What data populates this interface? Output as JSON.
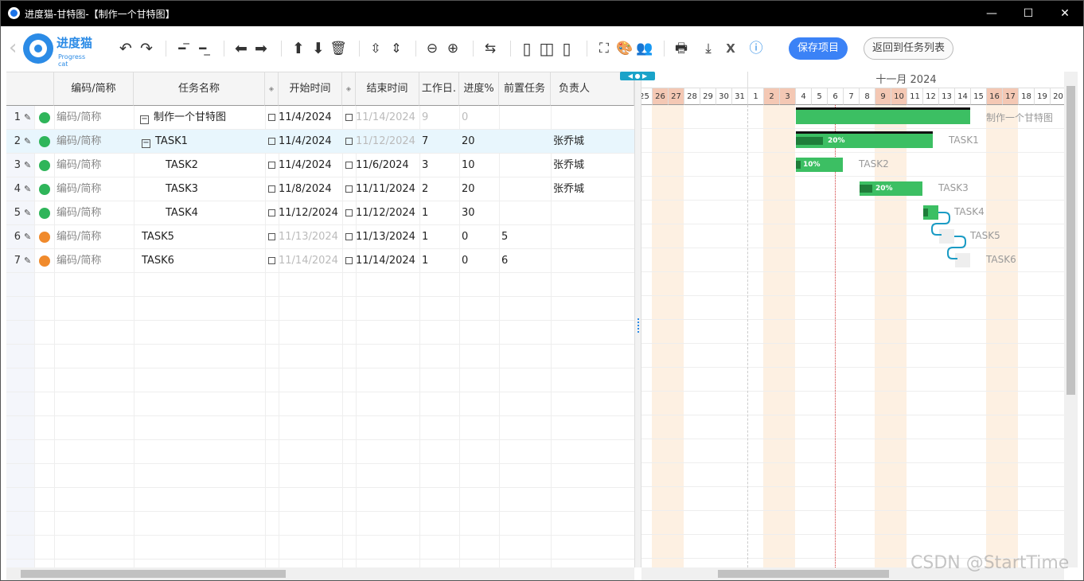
{
  "window": {
    "title": "进度猫-甘特图-【制作一个甘特图】",
    "minimize": "—",
    "maximize": "☐",
    "close": "✕"
  },
  "logo": {
    "name": "进度猫",
    "sub": "Progress cat"
  },
  "toolbar": {
    "icons": [
      "undo-icon",
      "redo-icon",
      "outdent-icon",
      "indent-icon",
      "arrow-left-icon",
      "arrow-right-icon",
      "arrow-up-icon",
      "arrow-down-icon",
      "delete-icon",
      "expand-icon",
      "collapse-icon",
      "zoom-out-icon",
      "zoom-in-icon",
      "link-icon",
      "layout-left-icon",
      "layout-split-icon",
      "layout-right-icon",
      "fullscreen-icon",
      "palette-icon",
      "users-icon",
      "print-icon",
      "download-icon",
      "excel-icon",
      "help-icon"
    ],
    "save_label": "保存项目",
    "back_label": "返回到任务列表"
  },
  "columns": {
    "code": "编码/简称",
    "name": "任务名称",
    "start": "开始时间",
    "end": "结束时间",
    "workdays": "工作日.",
    "progress": "进度%",
    "predecessor": "前置任务",
    "owner": "负责人"
  },
  "rows": [
    {
      "num": "1",
      "status": "green",
      "code": "编码/简称",
      "name": "制作一个甘特图",
      "start": "11/4/2024",
      "end": "11/14/2024",
      "workdays": "9",
      "progress": "0",
      "pred": "",
      "owner": ""
    },
    {
      "num": "2",
      "status": "green",
      "code": "编码/简称",
      "name": "TASK1",
      "start": "11/4/2024",
      "end": "11/12/2024",
      "workdays": "7",
      "progress": "20",
      "pred": "",
      "owner": "张乔城"
    },
    {
      "num": "3",
      "status": "green",
      "code": "编码/简称",
      "name": "TASK2",
      "start": "11/4/2024",
      "end": "11/6/2024",
      "workdays": "3",
      "progress": "10",
      "pred": "",
      "owner": "张乔城"
    },
    {
      "num": "4",
      "status": "green",
      "code": "编码/简称",
      "name": "TASK3",
      "start": "11/8/2024",
      "end": "11/11/2024",
      "workdays": "2",
      "progress": "20",
      "pred": "",
      "owner": "张乔城"
    },
    {
      "num": "5",
      "status": "green",
      "code": "编码/简称",
      "name": "TASK4",
      "start": "11/12/2024",
      "end": "11/12/2024",
      "workdays": "1",
      "progress": "30",
      "pred": "",
      "owner": ""
    },
    {
      "num": "6",
      "status": "orange",
      "code": "编码/简称",
      "name": "TASK5",
      "start": "11/13/2024",
      "end": "11/13/2024",
      "workdays": "1",
      "progress": "0",
      "pred": "5",
      "owner": ""
    },
    {
      "num": "7",
      "status": "orange",
      "code": "编码/简称",
      "name": "TASK6",
      "start": "11/14/2024",
      "end": "11/14/2024",
      "workdays": "1",
      "progress": "0",
      "pred": "6",
      "owner": ""
    }
  ],
  "gantt": {
    "month_label": "十一月 2024",
    "days": [
      "25",
      "26",
      "27",
      "28",
      "29",
      "30",
      "31",
      "1",
      "2",
      "3",
      "4",
      "5",
      "6",
      "7",
      "8",
      "9",
      "10",
      "11",
      "12",
      "13",
      "14",
      "15",
      "16",
      "17",
      "18",
      "19",
      "20"
    ],
    "bar_labels": [
      "制作一个甘特图",
      "TASK1",
      "TASK2",
      "TASK3",
      "TASK4",
      "TASK5",
      "TASK6"
    ],
    "pct_labels": [
      "20%",
      "10%",
      "20%"
    ],
    "progress": [
      0,
      0.2,
      0.1,
      0.2,
      0.3,
      0,
      0
    ]
  },
  "watermark": "CSDN @StartTime",
  "colors": {
    "accent": "#3b82f6",
    "bar": "#3cbf63",
    "bar_progress": "#1f7d3a",
    "status_green": "#2fb55a",
    "status_orange": "#f08a2c",
    "weekend": "#f4c8b4"
  }
}
